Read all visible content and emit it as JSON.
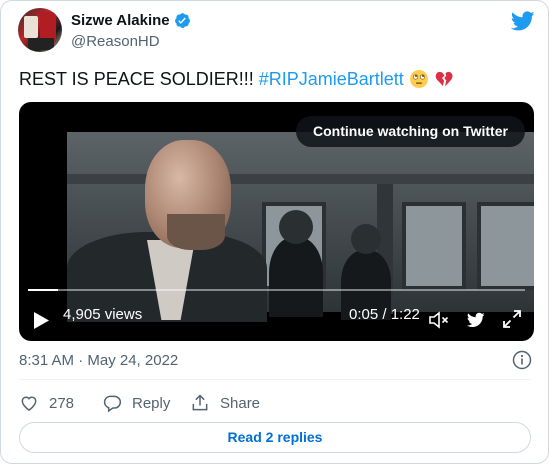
{
  "author": {
    "display_name": "Sizwe Alakine",
    "handle": "@ReasonHD"
  },
  "tweet": {
    "text_plain": "REST IS PEACE SOLDIER!!! ",
    "hashtag": "#RIPJamieBartlett",
    "emojis": [
      "face-with-rolling-eyes-emoji",
      "broken-heart-emoji"
    ]
  },
  "video": {
    "continue_label": "Continue watching on Twitter",
    "views": "4,905 views",
    "time": "0:05 / 1:22",
    "progress": 0.061
  },
  "meta": {
    "timestamp": "8:31 AM · May 24, 2022"
  },
  "actions": {
    "like_count": "278",
    "reply_label": "Reply",
    "share_label": "Share"
  },
  "read_replies_label": "Read 2 replies",
  "colors": {
    "accent": "#1d9bf0",
    "secondary_text": "#536471",
    "link_button": "#006fd6"
  },
  "icons": [
    "verified-badge-icon",
    "twitter-bird-icon",
    "play-icon",
    "volume-icon",
    "expand-icon",
    "info-icon",
    "heart-icon",
    "reply-icon",
    "share-icon"
  ]
}
